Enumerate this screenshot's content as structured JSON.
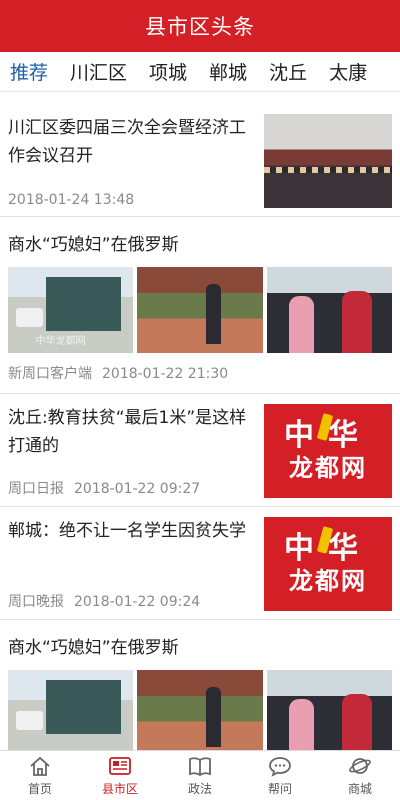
{
  "header": {
    "title": "县市区头条"
  },
  "tabs": [
    "推荐",
    "川汇区",
    "项城",
    "郸城",
    "沈丘",
    "太康"
  ],
  "feed": [
    {
      "headline": "川汇区委四届三次全会暨经济工作会议召开",
      "source": "",
      "time": "2018-01-24 13:48"
    },
    {
      "headline": "商水“巧媳妇”在俄罗斯",
      "source": "新周口客户端",
      "time": "2018-01-22 21:30",
      "watermark": "中华龙都网"
    },
    {
      "headline": "沈丘:教育扶贫“最后1米”是这样打通的",
      "source": "周口日报",
      "time": "2018-01-22 09:27"
    },
    {
      "headline": "郸城：绝不让一名学生因贫失学",
      "source": "周口晚报",
      "time": "2018-01-22 09:24"
    },
    {
      "headline": "商水“巧媳妇”在俄罗斯"
    }
  ],
  "logo": {
    "line1": "中华",
    "line2": "龙都网"
  },
  "bottom_nav": [
    {
      "label": "首页",
      "icon": "home-icon"
    },
    {
      "label": "县市区",
      "icon": "news-icon"
    },
    {
      "label": "政法",
      "icon": "book-icon"
    },
    {
      "label": "帮问",
      "icon": "chat-icon"
    },
    {
      "label": "商城",
      "icon": "planet-icon"
    }
  ],
  "colors": {
    "brand": "#d41f26",
    "tab_active": "#1e5fa8",
    "meta": "#8a8a8a"
  }
}
